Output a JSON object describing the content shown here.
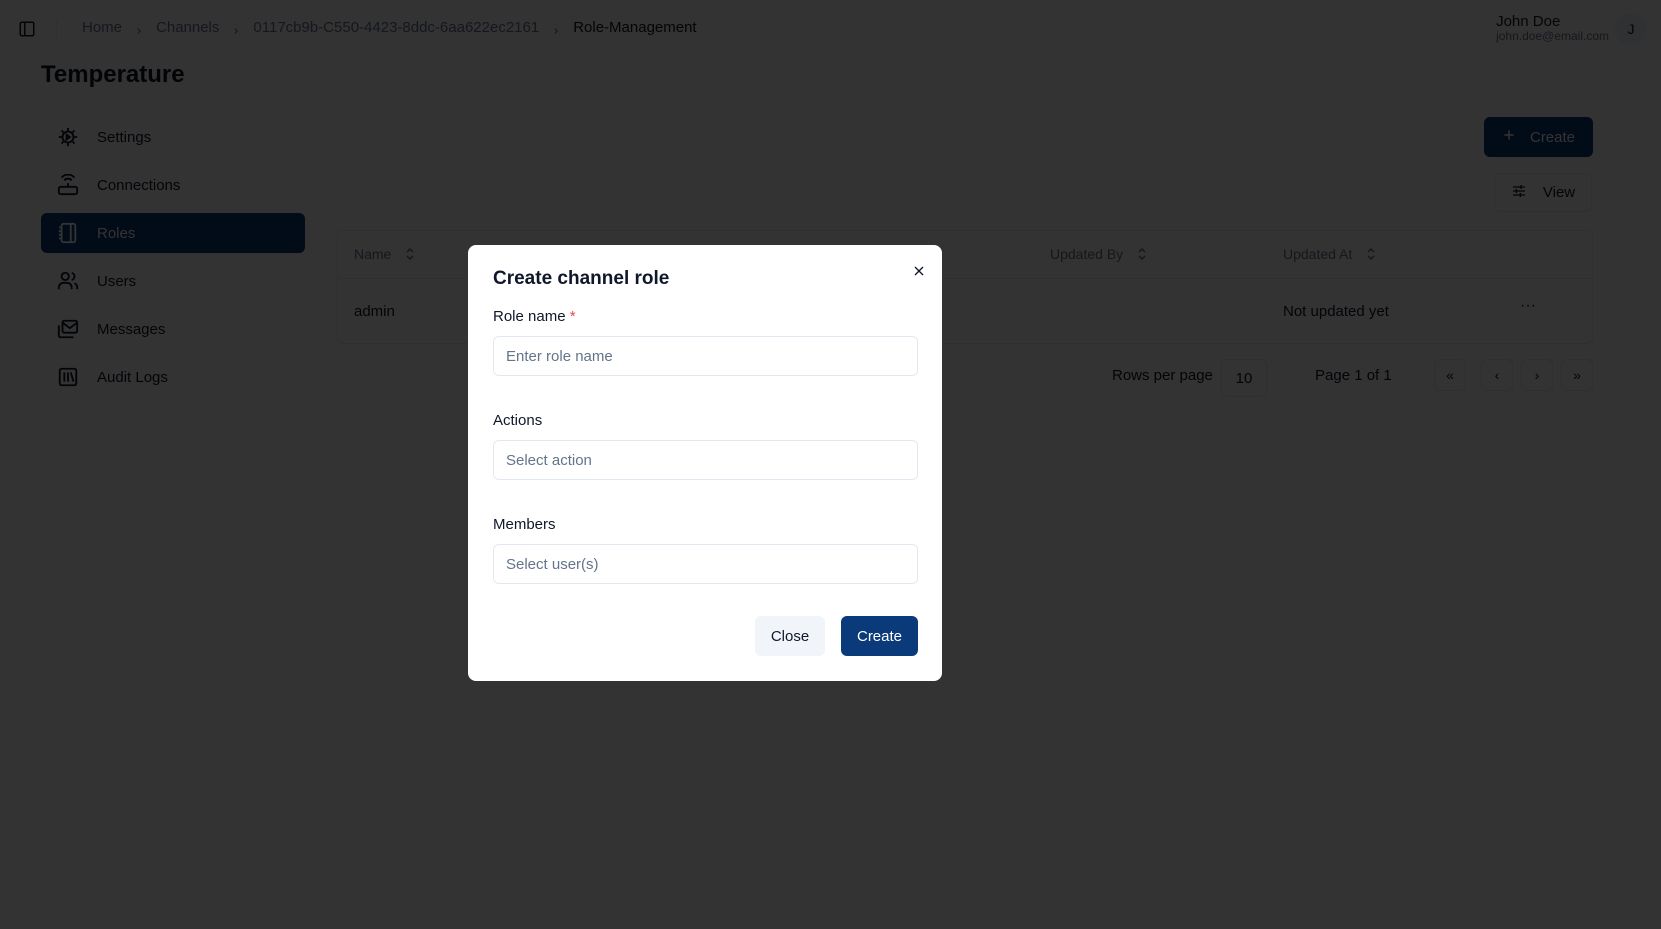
{
  "breadcrumb": [
    "Home",
    "Channels",
    "0117cb9b-C550-4423-8ddc-6aa622ec2161",
    "Role-Management"
  ],
  "user": {
    "name": "John Doe",
    "email": "john.doe@email.com",
    "initial": "J"
  },
  "page_title": "Temperature",
  "sidebar": {
    "items": [
      {
        "label": "Settings",
        "icon": "settings-icon"
      },
      {
        "label": "Connections",
        "icon": "router-icon"
      },
      {
        "label": "Roles",
        "icon": "notebook-icon",
        "active": true
      },
      {
        "label": "Users",
        "icon": "users-icon"
      },
      {
        "label": "Messages",
        "icon": "mail-icon"
      },
      {
        "label": "Audit Logs",
        "icon": "library-icon"
      }
    ]
  },
  "toolbar": {
    "create_label": "Create",
    "view_label": "View"
  },
  "table": {
    "columns": [
      "Name",
      "Updated By",
      "Updated At"
    ],
    "rows": [
      {
        "name": "admin",
        "updated_by": "",
        "updated_at": "Not updated yet"
      }
    ]
  },
  "pagination": {
    "rows_per_page_label": "Rows per page",
    "rows_per_page": "10",
    "page_label": "Page 1 of 1",
    "first": "«",
    "prev": "‹",
    "next": "›",
    "last": "»"
  },
  "dialog": {
    "title": "Create channel role",
    "role_name_label": "Role name",
    "required_mark": "*",
    "role_name_placeholder": "Enter role name",
    "actions_label": "Actions",
    "actions_placeholder": "Select action",
    "members_label": "Members",
    "members_placeholder": "Select user(s)",
    "close_label": "Close",
    "create_label": "Create"
  },
  "colors": {
    "primary": "#0b3a7a",
    "required": "#ef4444",
    "overlay": "rgba(0,0,0,0.8)"
  }
}
